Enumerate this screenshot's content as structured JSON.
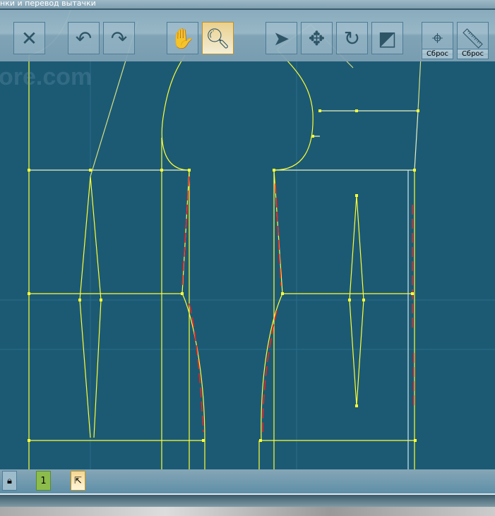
{
  "window": {
    "title": "нки и перевод вытачки"
  },
  "watermark": "ore.com",
  "toolbar": {
    "tools": [
      "close",
      "undo",
      "redo",
      "pan",
      "zoom",
      "select",
      "move",
      "rotate",
      "scale",
      "angle",
      "ruler"
    ],
    "active_tool": "zoom",
    "reset_label_1": "Сброс",
    "reset_label_2": "Сброс"
  },
  "bottom": {
    "layer_number": "1"
  },
  "colors": {
    "canvas": "#1c5a74",
    "line": "#ffff00",
    "highlight": "#ff0000",
    "point": "#c8d860"
  }
}
